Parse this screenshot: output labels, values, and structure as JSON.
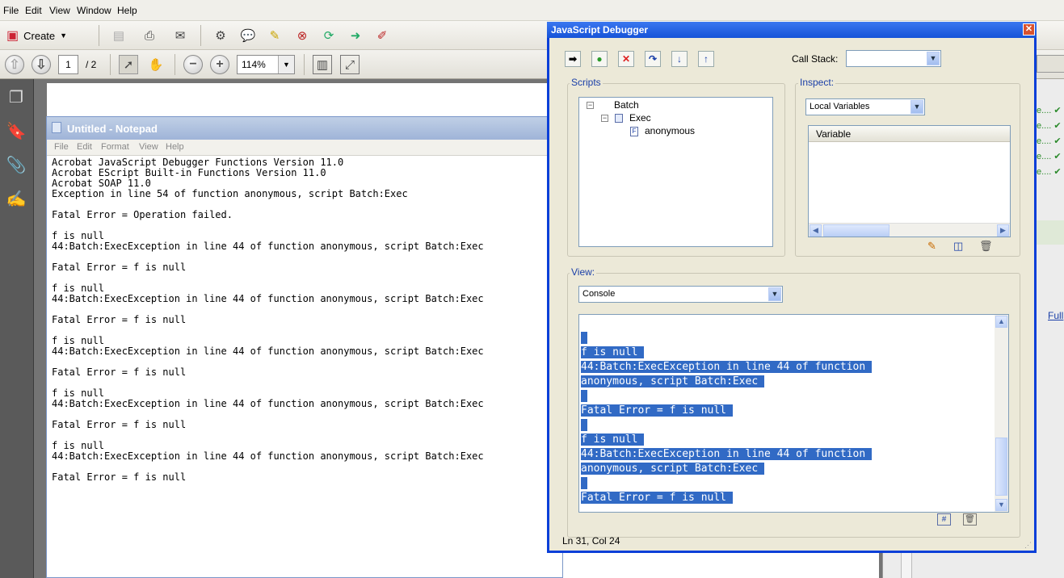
{
  "acrobat": {
    "menu": [
      "File",
      "Edit",
      "View",
      "Window",
      "Help"
    ],
    "create_label": "Create",
    "page_current": "1",
    "page_total": "/ 2",
    "zoom": "114%"
  },
  "notepad": {
    "title": "Untitled - Notepad",
    "menu": [
      "File",
      "Edit",
      "Format",
      "View",
      "Help"
    ],
    "lines": [
      "Acrobat JavaScript Debugger Functions Version 11.0",
      "Acrobat EScript Built-in Functions Version 11.0",
      "Acrobat SOAP 11.0",
      "Exception in line 54 of function anonymous, script Batch:Exec",
      "",
      "Fatal Error = Operation failed.",
      "",
      "f is null",
      "44:Batch:ExecException in line 44 of function anonymous, script Batch:Exec",
      "",
      "Fatal Error = f is null",
      "",
      "f is null",
      "44:Batch:ExecException in line 44 of function anonymous, script Batch:Exec",
      "",
      "Fatal Error = f is null",
      "",
      "f is null",
      "44:Batch:ExecException in line 44 of function anonymous, script Batch:Exec",
      "",
      "Fatal Error = f is null",
      "",
      "f is null",
      "44:Batch:ExecException in line 44 of function anonymous, script Batch:Exec",
      "",
      "Fatal Error = f is null",
      "",
      "f is null",
      "44:Batch:ExecException in line 44 of function anonymous, script Batch:Exec",
      "",
      "Fatal Error = f is null"
    ]
  },
  "debugger": {
    "title": "JavaScript Debugger",
    "call_stack_label": "Call Stack:",
    "scripts_label": "Scripts",
    "inspect_label": "Inspect:",
    "inspect_value": "Local Variables",
    "variable_header": "Variable",
    "tree": {
      "root": "Batch",
      "child": "Exec",
      "leaf": "anonymous"
    },
    "view_label": "View:",
    "view_value": "Console",
    "console_lines": [
      "",
      "f is null ",
      "44:Batch:ExecException in line 44 of function ",
      "anonymous, script Batch:Exec ",
      "",
      "Fatal Error = f is null ",
      "",
      "f is null ",
      "44:Batch:ExecException in line 44 of function ",
      "anonymous, script Batch:Exec ",
      "",
      "Fatal Error = f is null "
    ],
    "status": "Ln 31, Col 24"
  },
  "right_pane": {
    "link": "Full"
  },
  "colors": {
    "selection": "#316ac5",
    "titlebar": "#1653d8"
  }
}
